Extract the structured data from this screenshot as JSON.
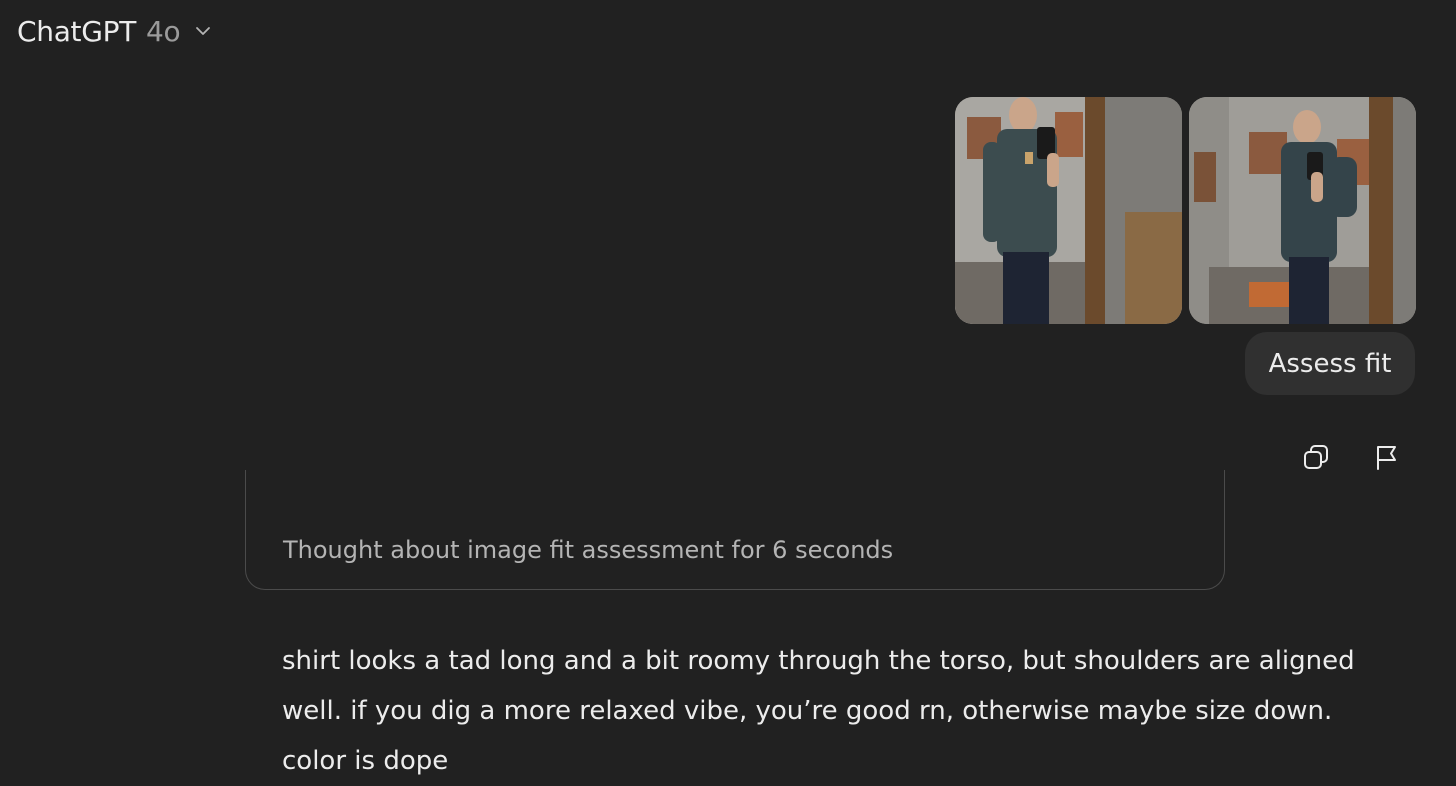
{
  "header": {
    "model_name": "ChatGPT",
    "model_version": "4o",
    "dropdown_icon": "chevron-down-icon"
  },
  "user_message": {
    "images": [
      {
        "alt": "mirror selfie 1"
      },
      {
        "alt": "mirror selfie 2"
      }
    ],
    "text": "Assess fit"
  },
  "message_actions": {
    "copy_icon": "copy-icon",
    "report_icon": "flag-icon"
  },
  "assistant": {
    "thought_label": "Thought about image fit assessment for 6 seconds",
    "response_text": "shirt looks a tad long and a bit roomy through the torso, but shoulders are aligned well. if you dig a more relaxed vibe, you’re good rn, otherwise maybe size down. color is dope"
  },
  "colors": {
    "background": "#212121",
    "bubble": "#303030",
    "text": "#ececec",
    "muted": "#9b9b9b"
  }
}
